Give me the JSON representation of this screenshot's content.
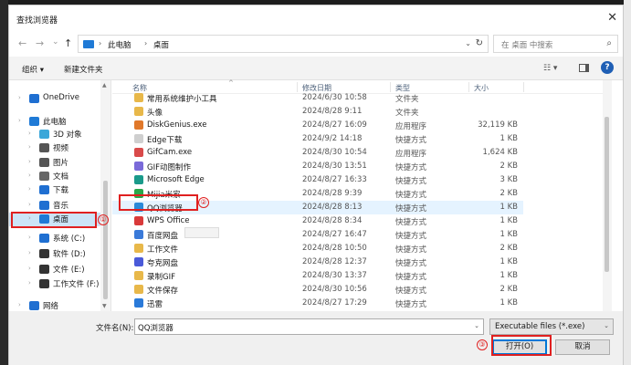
{
  "window": {
    "title": "查找浏览器",
    "close_glyph": "✕"
  },
  "nav": {
    "back": "←",
    "forward": "→",
    "recent": "⌄",
    "up": "↑"
  },
  "address": {
    "crumbs": [
      "此电脑",
      "桌面"
    ],
    "sep": "›",
    "dropdown": "⌄",
    "refresh": "↻"
  },
  "search": {
    "placeholder": "在 桌面 中搜索",
    "icon": "⌕"
  },
  "toolbar": {
    "organize": "组织 ▾",
    "new_folder": "新建文件夹",
    "view": "☷ ▾",
    "help": "?"
  },
  "navpane": {
    "items": [
      {
        "label": "OneDrive",
        "icon": "cloud-icon",
        "color": "#1f6fd1"
      },
      {
        "label": "此电脑",
        "icon": "computer-icon",
        "color": "#1f7ad6"
      },
      {
        "label": "3D 对象",
        "icon": "cube-icon",
        "color": "#3ba7d9"
      },
      {
        "label": "视频",
        "icon": "video-icon",
        "color": "#555555"
      },
      {
        "label": "图片",
        "icon": "picture-icon",
        "color": "#555555"
      },
      {
        "label": "文档",
        "icon": "document-icon",
        "color": "#666666"
      },
      {
        "label": "下载",
        "icon": "download-icon",
        "color": "#1f6fd1"
      },
      {
        "label": "音乐",
        "icon": "music-icon",
        "color": "#1f6fd1"
      },
      {
        "label": "桌面",
        "icon": "desktop-icon",
        "color": "#1f7ad6"
      },
      {
        "label": "系统 (C:)",
        "icon": "drive-c-icon",
        "color": "#1f6fd1"
      },
      {
        "label": "软件 (D:)",
        "icon": "drive-icon",
        "color": "#333333"
      },
      {
        "label": "文件 (E:)",
        "icon": "drive-icon",
        "color": "#333333"
      },
      {
        "label": "工作文件 (F:)",
        "icon": "drive-icon",
        "color": "#333333"
      },
      {
        "label": "网络",
        "icon": "network-icon",
        "color": "#1f6fd1"
      }
    ]
  },
  "columns": {
    "name": "名称",
    "date": "修改日期",
    "type": "类型",
    "size": "大小",
    "sort": "^"
  },
  "files": [
    {
      "name": "常用系统维护小工具",
      "date": "2024/6/30 10:58",
      "type": "文件夹",
      "size": "",
      "color": "#e8b84a"
    },
    {
      "name": "头像",
      "date": "2024/8/28 9:11",
      "type": "文件夹",
      "size": "",
      "color": "#e8b84a"
    },
    {
      "name": "DiskGenius.exe",
      "date": "2024/8/27 16:09",
      "type": "应用程序",
      "size": "32,119 KB",
      "color": "#e0782a"
    },
    {
      "name": "Edge下载",
      "date": "2024/9/2 14:18",
      "type": "快捷方式",
      "size": "1 KB",
      "color": "#cfcfcf"
    },
    {
      "name": "GifCam.exe",
      "date": "2024/8/30 10:54",
      "type": "应用程序",
      "size": "1,624 KB",
      "color": "#d94a4a"
    },
    {
      "name": "GIF动图制作",
      "date": "2024/8/30 13:51",
      "type": "快捷方式",
      "size": "2 KB",
      "color": "#7a6ad9"
    },
    {
      "name": "Microsoft Edge",
      "date": "2024/8/27 16:33",
      "type": "快捷方式",
      "size": "3 KB",
      "color": "#1a9a8a"
    },
    {
      "name": "Mijia米家",
      "date": "2024/8/28 9:39",
      "type": "快捷方式",
      "size": "2 KB",
      "color": "#2aa84a"
    },
    {
      "name": "QQ浏览器",
      "date": "2024/8/28 8:13",
      "type": "快捷方式",
      "size": "1 KB",
      "color": "#2a8ad9"
    },
    {
      "name": "WPS Office",
      "date": "2024/8/28 8:34",
      "type": "快捷方式",
      "size": "1 KB",
      "color": "#d93a3a"
    },
    {
      "name": "百度网盘",
      "date": "2024/8/27 16:47",
      "type": "快捷方式",
      "size": "1 KB",
      "color": "#3a7ad9"
    },
    {
      "name": "工作文件",
      "date": "2024/8/28 10:50",
      "type": "快捷方式",
      "size": "2 KB",
      "color": "#e8b84a"
    },
    {
      "name": "夸克网盘",
      "date": "2024/8/28 12:37",
      "type": "快捷方式",
      "size": "1 KB",
      "color": "#4a5ad9"
    },
    {
      "name": "录制GIF",
      "date": "2024/8/30 13:37",
      "type": "快捷方式",
      "size": "1 KB",
      "color": "#e8b84a"
    },
    {
      "name": "文件保存",
      "date": "2024/8/30 10:56",
      "type": "快捷方式",
      "size": "2 KB",
      "color": "#e8b84a"
    },
    {
      "name": "迅雷",
      "date": "2024/8/27 17:29",
      "type": "快捷方式",
      "size": "1 KB",
      "color": "#2a7ad9"
    }
  ],
  "bottom": {
    "filename_label": "文件名(N):",
    "filename_value": "QQ浏览器",
    "filter": "Executable files (*.exe)",
    "open": "打开(O)",
    "cancel": "取消"
  },
  "annotations": {
    "c1": "①",
    "c2": "②",
    "c3": "③"
  }
}
